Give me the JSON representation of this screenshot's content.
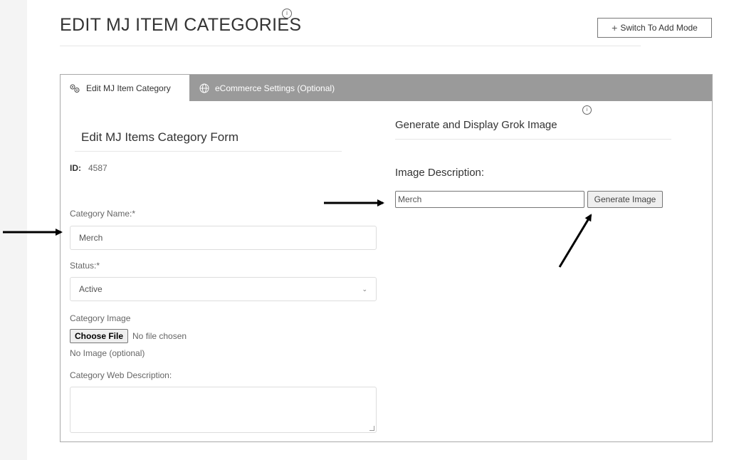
{
  "page": {
    "title": "EDIT MJ ITEM CATEGORIES",
    "switch_button_label": "Switch To Add Mode"
  },
  "tabs": [
    {
      "label": "Edit MJ Item Category",
      "icon": "gears-icon",
      "active": true
    },
    {
      "label": "eCommerce Settings (Optional)",
      "icon": "globe-icon",
      "active": false
    }
  ],
  "form": {
    "heading": "Edit MJ Items Category Form",
    "id_label": "ID:",
    "id_value": "4587",
    "category_name_label": "Category Name:*",
    "category_name_value": "Merch",
    "status_label": "Status:*",
    "status_value": "Active",
    "category_image_label": "Category Image",
    "choose_file_label": "Choose File",
    "no_file_text": "No file chosen",
    "no_image_text": "No Image (optional)",
    "web_description_label": "Category Web Description:"
  },
  "grok": {
    "heading": "Generate and Display Grok Image",
    "image_description_label": "Image Description:",
    "image_description_value": "Merch",
    "generate_button_label": "Generate Image"
  },
  "colors": {
    "tabbar": "#9a9a9a",
    "border": "#a9a9a9"
  }
}
